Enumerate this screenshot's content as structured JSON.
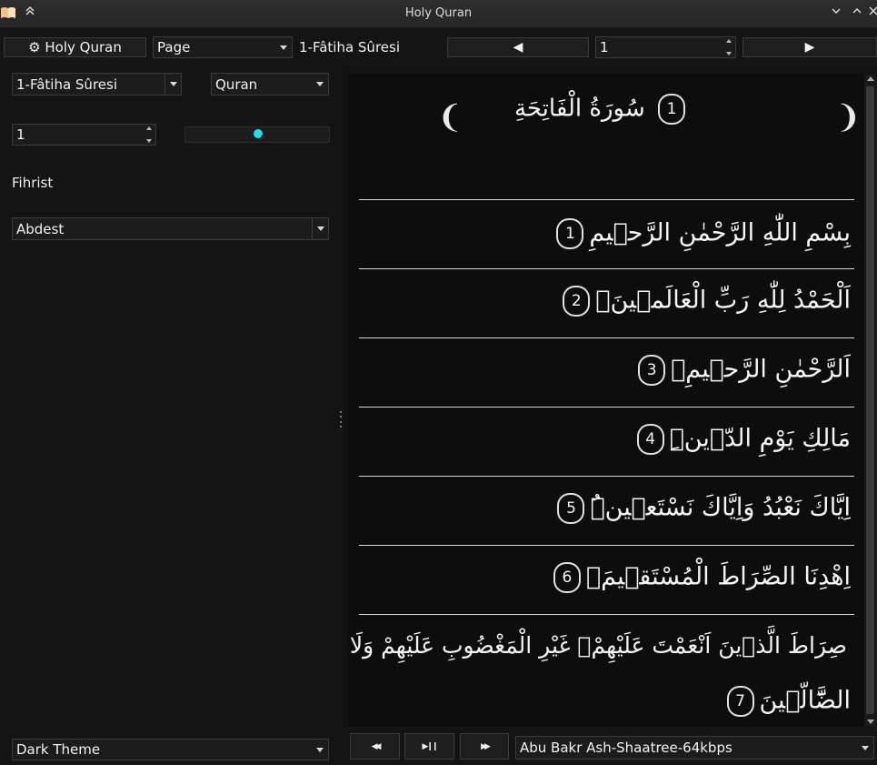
{
  "window": {
    "title": "Holy Quran"
  },
  "toolbar": {
    "settings_label": "⚙ Holy Quran",
    "view_mode": "Page",
    "current_surah": "1-Fâtiha Sûresi",
    "page_number": "1",
    "prev_glyph": "◀",
    "next_glyph": "▶"
  },
  "left": {
    "surah_select": "1-Fâtiha Sûresi",
    "text_select": "Quran",
    "ayah_number": "1",
    "fihrist_label": "Fihrist",
    "fihrist_select": "Abdest",
    "theme_select": "Dark Theme",
    "zoom_level": 0.5
  },
  "reader": {
    "surah_title": "سُورَةُ الْفَاتِحَةِ",
    "surah_index": "1",
    "ayahs": [
      {
        "text": "بِسْمِ اللّٰهِ الرَّحْمٰنِ الرَّح۪يمِ",
        "num": "1"
      },
      {
        "text": "اَلْحَمْدُ لِلّٰهِ رَبِّ الْعَالَم۪ينَۙ",
        "num": "2"
      },
      {
        "text": "اَلرَّحْمٰنِ الرَّح۪يمِۙ",
        "num": "3"
      },
      {
        "text": "مَالِكِ يَوْمِ الدّ۪ينِۜ",
        "num": "4"
      },
      {
        "text": "اِيَّاكَ نَعْبُدُ وَاِيَّاكَ نَسْتَع۪ينُۜ",
        "num": "5"
      },
      {
        "text": "اِهْدِنَا الصِّرَاطَ الْمُسْتَق۪يمَۙ",
        "num": "6"
      },
      {
        "text1": "صِرَاطَ الَّذ۪ينَ اَنْعَمْتَ عَلَيْهِمْۙ غَيْرِ الْمَغْضُوبِ عَلَيْهِمْ وَلَا",
        "text2": "الضَّٓالّ۪ينَ",
        "num": "7"
      }
    ]
  },
  "player": {
    "rewind_glyph": "◀◀",
    "playpause_glyph": "▶❙❙",
    "forward_glyph": "▶▶",
    "reciter": "Abu Bakr Ash-Shaatree-64kbps"
  }
}
